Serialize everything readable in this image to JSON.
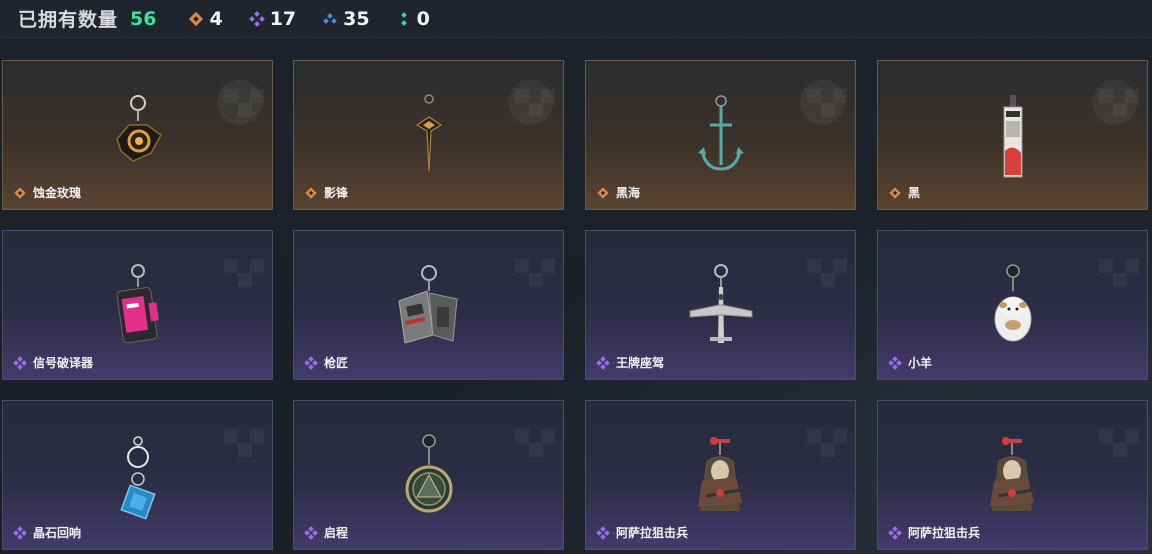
{
  "header": {
    "owned_label": "已拥有数量",
    "owned_count": "56",
    "stats": [
      {
        "icon": "orange-diamond-icon",
        "color": "#d98a4a",
        "value": "4"
      },
      {
        "icon": "purple-diamond-icon",
        "color": "#9a6ee8",
        "value": "17"
      },
      {
        "icon": "blue-diamond-icon",
        "color": "#4a8ee0",
        "value": "35"
      },
      {
        "icon": "green-diamond-icon",
        "color": "#3ad6a0",
        "value": "0"
      }
    ]
  },
  "colors": {
    "owned_count": "#39e29a",
    "orange_rarity": "#d98a4a",
    "purple_rarity": "#9a6ee8"
  },
  "items": [
    {
      "name": "蚀金玫瑰",
      "rarity": "orange",
      "charm": "rose-charm-icon"
    },
    {
      "name": "影锋",
      "rarity": "orange",
      "charm": "blade-charm-icon"
    },
    {
      "name": "黑海",
      "rarity": "orange",
      "charm": "anchor-charm-icon"
    },
    {
      "name": "黑",
      "rarity": "orange",
      "charm": "tag-charm-icon"
    },
    {
      "name": "信号破译器",
      "rarity": "purple",
      "charm": "decoder-charm-icon"
    },
    {
      "name": "枪匠",
      "rarity": "purple",
      "charm": "dogtag-charm-icon"
    },
    {
      "name": "王牌座驾",
      "rarity": "purple",
      "charm": "jet-charm-icon"
    },
    {
      "name": "小羊",
      "rarity": "purple",
      "charm": "sheep-charm-icon"
    },
    {
      "name": "晶石回响",
      "rarity": "purple",
      "charm": "crystal-charm-icon"
    },
    {
      "name": "启程",
      "rarity": "purple",
      "charm": "medal-charm-icon"
    },
    {
      "name": "阿萨拉狙击兵",
      "rarity": "purple",
      "charm": "sniper-charm-icon"
    },
    {
      "name": "阿萨拉狙击兵",
      "rarity": "purple",
      "charm": "sniper-charm-icon"
    }
  ]
}
